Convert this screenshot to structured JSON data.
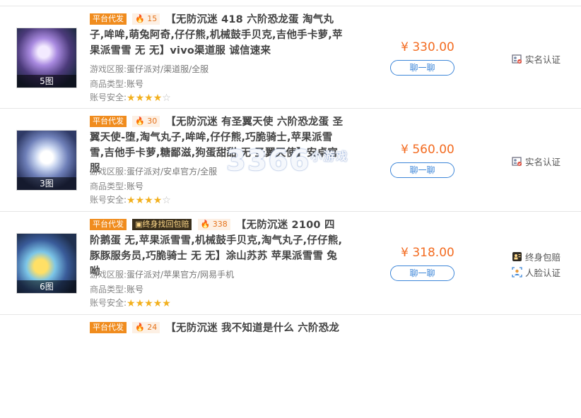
{
  "listings": [
    {
      "image_count": "5图",
      "tags": [
        {
          "text": "平台代发",
          "style": "orange"
        }
      ],
      "heat": "15",
      "title": "【无防沉迷 418 六阶恐龙蛋 淘气丸子,哞哞,萌兔阿奇,仔仔熊,机械鼓手贝克,吉他手卡萝,苹果派雪雪 无 无】vivo渠道服 诚信速来",
      "server_label": "游戏区服:",
      "server": "蛋仔派对/渠道服/全服",
      "type_label": "商品类型:",
      "type": "账号",
      "security_label": "账号安全:",
      "security_stars": 4,
      "price": "¥ 330.00",
      "chat_label": "聊一聊",
      "badges": [
        {
          "text": "实名认证",
          "icon": "id-card-icon"
        }
      ]
    },
    {
      "image_count": "3图",
      "tags": [
        {
          "text": "平台代发",
          "style": "orange"
        }
      ],
      "heat": "30",
      "title": "【无防沉迷 有圣翼天使 六阶恐龙蛋 圣翼天使-堕,淘气丸子,哞哞,仔仔熊,巧脆骑士,苹果派雪雪,吉他手卡萝,糖鄙滋,狗蛋甜甜 无 圣翼天使】安卓官服",
      "server_label": "游戏区服:",
      "server": "蛋仔派对/安卓官方/全服",
      "type_label": "商品类型:",
      "type": "账号",
      "security_label": "账号安全:",
      "security_stars": 4,
      "price": "¥ 560.00",
      "chat_label": "聊一聊",
      "badges": [
        {
          "text": "实名认证",
          "icon": "id-card-icon"
        }
      ]
    },
    {
      "image_count": "6图",
      "tags": [
        {
          "text": "平台代发",
          "style": "orange"
        },
        {
          "text": "终身找回包赔",
          "style": "gold"
        }
      ],
      "heat": "338",
      "title": "【无防沉迷 2100 四阶鹅蛋 无,苹果派雪雪,机械鼓手贝克,淘气丸子,仔仔熊,豚豚服务员,巧脆骑士 无 无】涂山苏苏 苹果派雪雪 兔呦",
      "server_label": "游戏区服:",
      "server": "蛋仔派对/苹果官方/网易手机",
      "type_label": "商品类型:",
      "type": "账号",
      "security_label": "账号安全:",
      "security_stars": 5,
      "price": "¥ 318.00",
      "chat_label": "聊一聊",
      "badges": [
        {
          "text": "终身包赔",
          "icon": "shield-person-icon"
        },
        {
          "text": "人脸认证",
          "icon": "face-id-icon"
        }
      ]
    },
    {
      "tags": [
        {
          "text": "平台代发",
          "style": "orange"
        }
      ],
      "heat": "24",
      "title": "【无防沉迷 我不知道是什么 六阶恐龙"
    }
  ],
  "watermark": {
    "main": "3366",
    "small": "小游戏"
  },
  "colors": {
    "price": "#f36b20",
    "accent_blue": "#3d86d8",
    "tag_orange": "#f08c1e",
    "star": "#f2b01e"
  }
}
